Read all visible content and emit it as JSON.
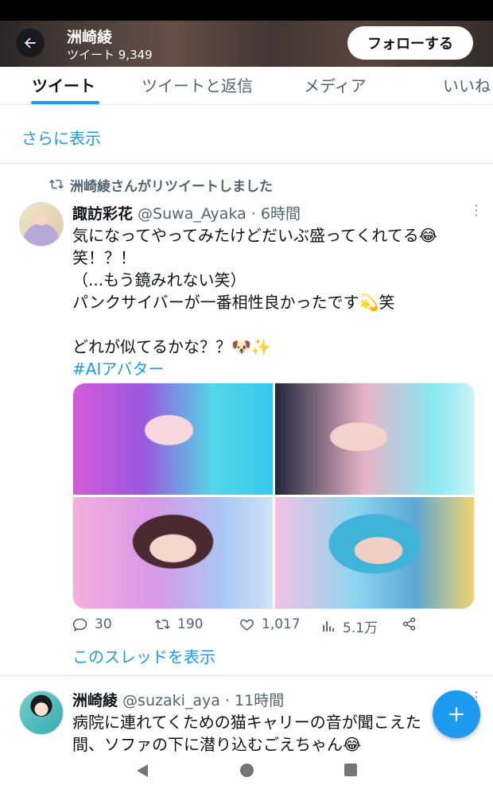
{
  "header": {
    "title": "洲崎綾",
    "subtitle": "ツイート 9,349",
    "follow_label": "フォローする"
  },
  "tabs": [
    {
      "label": "ツイート",
      "active": true
    },
    {
      "label": "ツイートと返信",
      "active": false
    },
    {
      "label": "メディア",
      "active": false
    },
    {
      "label": "いいね",
      "active": false
    }
  ],
  "show_more": "さらに表示",
  "tweet1": {
    "retweet_note": "洲崎綾さんがリツイートしました",
    "name": "諏訪彩花",
    "meta": " @Suwa_Ayaka · 6時間",
    "body": "気になってやってみたけどだいぶ盛ってくれてる😂\n笑！？！\n（...もう鏡みれない笑）\nパンクサイバーが一番相性良かったです💫笑\n\nどれが似てるかな？？🐶✨",
    "hashtag": "#AIアバター",
    "stats": {
      "replies": "30",
      "retweets": "190",
      "likes": "1,017",
      "views": "5.1万"
    },
    "thread_link": "このスレッドを表示"
  },
  "tweet2": {
    "name": "洲崎綾",
    "meta": " @suzaki_aya · 11時間",
    "body": "病院に連れてくための猫キャリーの音が聞こえた\n間、ソファの下に潜り込むごえちゃん😂"
  },
  "colors": {
    "accent": "#1d9bf0",
    "text": "#0f1419",
    "muted": "#536471"
  }
}
